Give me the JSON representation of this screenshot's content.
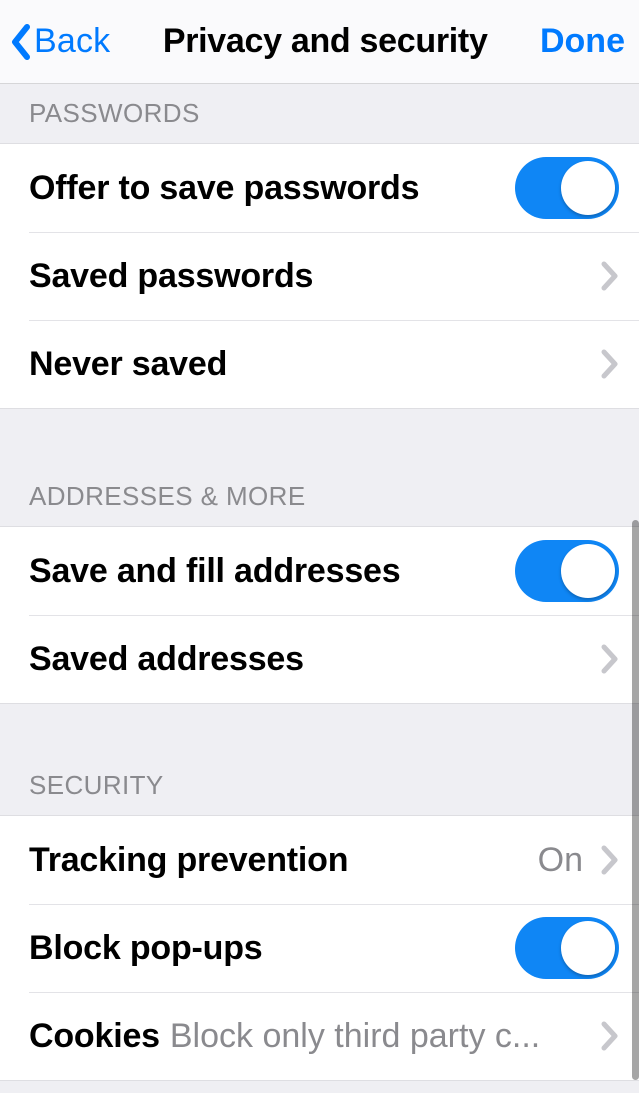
{
  "nav": {
    "back_label": "Back",
    "title": "Privacy and security",
    "done_label": "Done"
  },
  "sections": {
    "passwords": {
      "header": "PASSWORDS",
      "rows": {
        "offer_save": "Offer to save passwords",
        "saved": "Saved passwords",
        "never": "Never saved"
      }
    },
    "addresses": {
      "header": "ADDRESSES & MORE",
      "rows": {
        "save_fill": "Save and fill addresses",
        "saved": "Saved addresses"
      }
    },
    "security": {
      "header": "SECURITY",
      "rows": {
        "tracking_label": "Tracking prevention",
        "tracking_value": "On",
        "popups": "Block pop-ups",
        "cookies_label": "Cookies",
        "cookies_value": "Block only third party c..."
      }
    }
  },
  "toggles": {
    "offer_save_passwords": true,
    "save_fill_addresses": true,
    "block_popups": true
  },
  "colors": {
    "accent": "#007aff",
    "toggle_on": "#0f86f5",
    "bg": "#efeff3",
    "header_text": "#8a8a8e"
  }
}
